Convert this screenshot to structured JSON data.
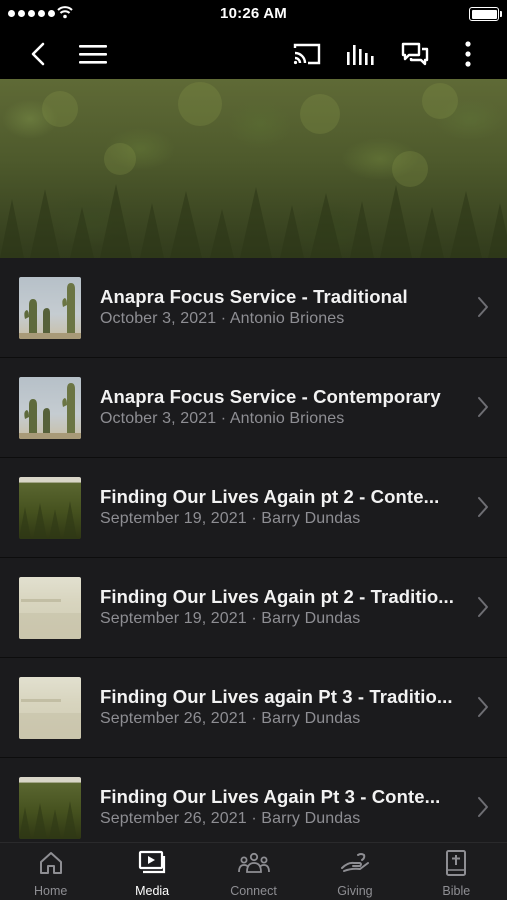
{
  "status_bar": {
    "time": "10:26 AM"
  },
  "nav": {
    "back": "back-icon",
    "menu": "hamburger-menu-icon",
    "cast": "cast-icon",
    "audio": "audio-bars-icon",
    "chat": "chat-icon",
    "more": "more-vertical-icon"
  },
  "hero": {
    "image": "forest-treetops-banner"
  },
  "media_items": [
    {
      "title": "Anapra Focus Service - Traditional",
      "subtitle": "October 3, 2021 · Antonio Briones",
      "thumbnail": "cactus"
    },
    {
      "title": "Anapra Focus Service - Contemporary",
      "subtitle": "October 3, 2021 · Antonio Briones",
      "thumbnail": "cactus"
    },
    {
      "title": "Finding Our Lives Again pt 2 - Conte...",
      "subtitle": "September 19, 2021 · Barry Dundas",
      "thumbnail": "forest"
    },
    {
      "title": "Finding Our Lives Again pt 2 - Traditio...",
      "subtitle": "September 19, 2021 · Barry Dundas",
      "thumbnail": "pale-title"
    },
    {
      "title": "Finding Our Lives again Pt 3 - Traditio...",
      "subtitle": "September 26, 2021 · Barry Dundas",
      "thumbnail": "pale-title"
    },
    {
      "title": "Finding Our Lives Again Pt 3 - Conte...",
      "subtitle": "September 26, 2021 · Barry Dundas",
      "thumbnail": "forest"
    }
  ],
  "tabs": [
    {
      "label": "Home",
      "icon": "home-icon",
      "active": false
    },
    {
      "label": "Media",
      "icon": "media-icon",
      "active": true
    },
    {
      "label": "Connect",
      "icon": "people-icon",
      "active": false
    },
    {
      "label": "Giving",
      "icon": "giving-hand-icon",
      "active": false
    },
    {
      "label": "Bible",
      "icon": "bible-icon",
      "active": false
    }
  ],
  "colors": {
    "background": "#000000",
    "row": "#1b1b1d",
    "subtitle": "#8e8e93",
    "tab_bar": "#1c1c1e"
  }
}
